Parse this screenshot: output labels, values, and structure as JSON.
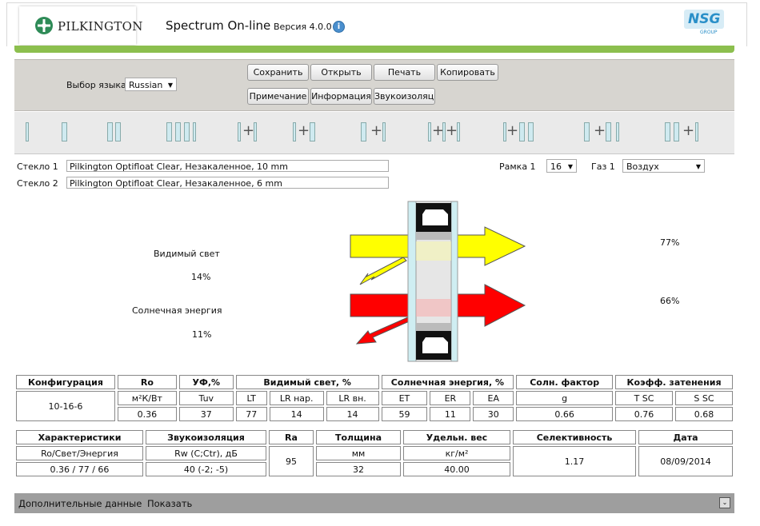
{
  "header": {
    "logo_text": "PILKINGTON",
    "app_title": "Spectrum On-line",
    "version": "Версия 4.0.0",
    "nsg_logo": "NSG",
    "nsg_sub": "GROUP"
  },
  "toolbar": {
    "language_label": "Выбор языка",
    "language_value": "Russian",
    "buttons": {
      "save": "Сохранить",
      "open": "Открыть",
      "print": "Печать",
      "copy": "Копировать",
      "note": "Примечание",
      "info": "Информация",
      "sound": "Звукоизоляция"
    }
  },
  "glass": {
    "glass1_label": "Стекло 1",
    "glass1_value": "Pilkington Optifloat Clear, Незакаленное, 10 mm",
    "glass2_label": "Стекло 2",
    "glass2_value": "Pilkington Optifloat Clear, Незакаленное, 6 mm",
    "frame_label": "Рамка 1",
    "frame_value": "16",
    "gas_label": "Газ 1",
    "gas_value": "Воздух"
  },
  "diagram": {
    "visible_light_label": "Видимый свет",
    "visible_reflected": "14%",
    "visible_transmitted": "77%",
    "solar_label": "Солнечная энергия",
    "solar_reflected": "11%",
    "solar_transmitted": "66%",
    "colors": {
      "light": "#ffff00",
      "solar": "#ff0000",
      "glass": "#cfeef2"
    }
  },
  "table1": {
    "headers": [
      "Конфигурация",
      "Ro",
      "УФ,%",
      "Видимый свет, %",
      "Солнечная энергия, %",
      "Солн. фактор",
      "Коэфф. затенения"
    ],
    "config": "10-16-6",
    "units": [
      "м²К/Вт",
      "Tuv",
      "LT",
      "LR нар.",
      "LR вн.",
      "ET",
      "ER",
      "EA",
      "g",
      "T SC",
      "S SC"
    ],
    "values": [
      "0.36",
      "37",
      "77",
      "14",
      "14",
      "59",
      "11",
      "30",
      "0.66",
      "0.76",
      "0.68"
    ]
  },
  "table2": {
    "headers": [
      "Характеристики",
      "Звукоизоляция",
      "Ra",
      "Толщина",
      "Удельн. вес",
      "Селективность",
      "Дата"
    ],
    "sub": [
      "Ro/Свет/Энергия",
      "Rw (C;Ctr), дБ",
      "мм",
      "кг/м²"
    ],
    "values": [
      "0.36 / 77 / 66",
      "40 (-2; -5)",
      "32",
      "40.00"
    ],
    "ra": "95",
    "selectivity": "1.17",
    "date": "08/09/2014"
  },
  "footer": {
    "label": "Дополнительные данные",
    "show": "Показать"
  }
}
